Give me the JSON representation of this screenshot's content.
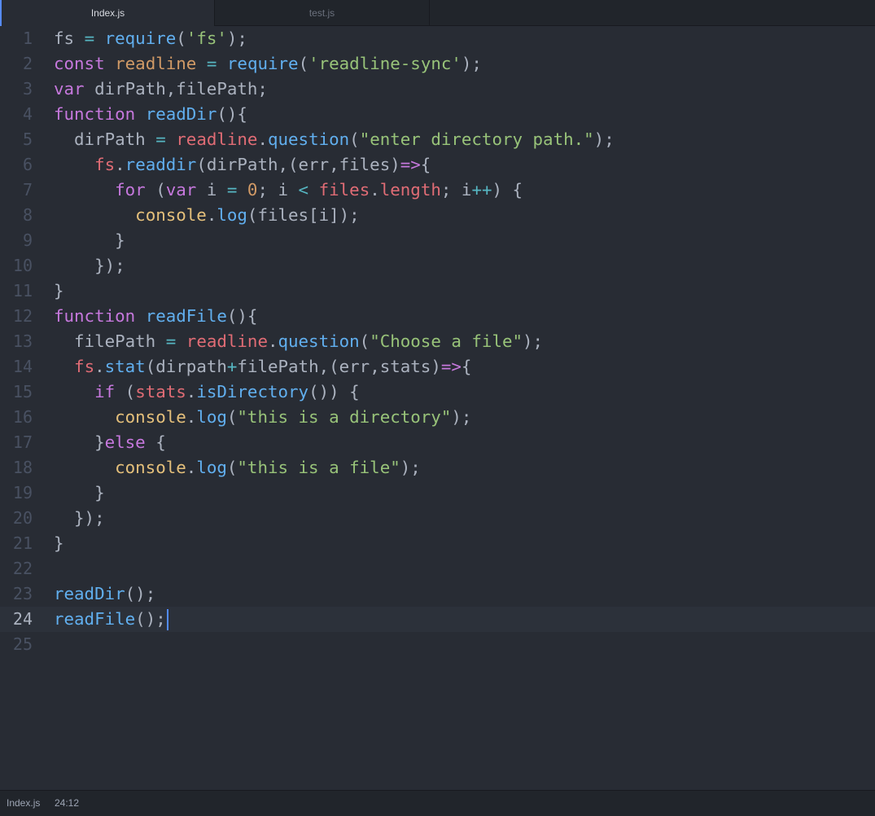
{
  "tabs": [
    {
      "label": "Index.js",
      "active": true
    },
    {
      "label": "test.js",
      "active": false
    }
  ],
  "editor": {
    "language": "javascript",
    "current_line": 24,
    "lines": [
      {
        "n": "1",
        "tokens": [
          [
            "d",
            "fs "
          ],
          [
            "o",
            "="
          ],
          [
            "d",
            " "
          ],
          [
            "f",
            "require"
          ],
          [
            "d",
            "("
          ],
          [
            "s",
            "'fs'"
          ],
          [
            "d",
            ");"
          ]
        ]
      },
      {
        "n": "2",
        "tokens": [
          [
            "k",
            "const"
          ],
          [
            "d",
            " "
          ],
          [
            "n",
            "readline"
          ],
          [
            "d",
            " "
          ],
          [
            "o",
            "="
          ],
          [
            "d",
            " "
          ],
          [
            "f",
            "require"
          ],
          [
            "d",
            "("
          ],
          [
            "s",
            "'readline-sync'"
          ],
          [
            "d",
            ");"
          ]
        ]
      },
      {
        "n": "3",
        "tokens": [
          [
            "k",
            "var"
          ],
          [
            "d",
            " dirPath,filePath;"
          ]
        ]
      },
      {
        "n": "4",
        "tokens": [
          [
            "k",
            "function"
          ],
          [
            "d",
            " "
          ],
          [
            "f",
            "readDir"
          ],
          [
            "d",
            "(){"
          ]
        ]
      },
      {
        "n": "5",
        "tokens": [
          [
            "d",
            "  dirPath "
          ],
          [
            "o",
            "="
          ],
          [
            "d",
            " "
          ],
          [
            "v",
            "readline"
          ],
          [
            "d",
            "."
          ],
          [
            "f",
            "question"
          ],
          [
            "d",
            "("
          ],
          [
            "s",
            "\"enter directory path.\""
          ],
          [
            "d",
            ");"
          ]
        ]
      },
      {
        "n": "6",
        "tokens": [
          [
            "d",
            "    "
          ],
          [
            "v",
            "fs"
          ],
          [
            "d",
            "."
          ],
          [
            "f",
            "readdir"
          ],
          [
            "d",
            "(dirPath,(err,files)"
          ],
          [
            "k",
            "=>"
          ],
          [
            "d",
            "{"
          ]
        ]
      },
      {
        "n": "7",
        "tokens": [
          [
            "d",
            "      "
          ],
          [
            "k",
            "for"
          ],
          [
            "d",
            " ("
          ],
          [
            "k",
            "var"
          ],
          [
            "d",
            " i "
          ],
          [
            "o",
            "="
          ],
          [
            "d",
            " "
          ],
          [
            "n",
            "0"
          ],
          [
            "d",
            "; i "
          ],
          [
            "o",
            "<"
          ],
          [
            "d",
            " "
          ],
          [
            "v",
            "files"
          ],
          [
            "d",
            "."
          ],
          [
            "v",
            "length"
          ],
          [
            "d",
            "; i"
          ],
          [
            "o",
            "++"
          ],
          [
            "d",
            ") {"
          ]
        ]
      },
      {
        "n": "8",
        "tokens": [
          [
            "d",
            "        "
          ],
          [
            "c",
            "console"
          ],
          [
            "d",
            "."
          ],
          [
            "f",
            "log"
          ],
          [
            "d",
            "(files[i]);"
          ]
        ]
      },
      {
        "n": "9",
        "tokens": [
          [
            "d",
            "      }"
          ]
        ]
      },
      {
        "n": "10",
        "tokens": [
          [
            "d",
            "    });"
          ]
        ]
      },
      {
        "n": "11",
        "tokens": [
          [
            "d",
            "}"
          ]
        ]
      },
      {
        "n": "12",
        "tokens": [
          [
            "k",
            "function"
          ],
          [
            "d",
            " "
          ],
          [
            "f",
            "readFile"
          ],
          [
            "d",
            "(){"
          ]
        ]
      },
      {
        "n": "13",
        "tokens": [
          [
            "d",
            "  filePath "
          ],
          [
            "o",
            "="
          ],
          [
            "d",
            " "
          ],
          [
            "v",
            "readline"
          ],
          [
            "d",
            "."
          ],
          [
            "f",
            "question"
          ],
          [
            "d",
            "("
          ],
          [
            "s",
            "\"Choose a file\""
          ],
          [
            "d",
            ");"
          ]
        ]
      },
      {
        "n": "14",
        "tokens": [
          [
            "d",
            "  "
          ],
          [
            "v",
            "fs"
          ],
          [
            "d",
            "."
          ],
          [
            "f",
            "stat"
          ],
          [
            "d",
            "(dirpath"
          ],
          [
            "o",
            "+"
          ],
          [
            "d",
            "filePath,(err,stats)"
          ],
          [
            "k",
            "=>"
          ],
          [
            "d",
            "{"
          ]
        ]
      },
      {
        "n": "15",
        "tokens": [
          [
            "d",
            "    "
          ],
          [
            "k",
            "if"
          ],
          [
            "d",
            " ("
          ],
          [
            "v",
            "stats"
          ],
          [
            "d",
            "."
          ],
          [
            "f",
            "isDirectory"
          ],
          [
            "d",
            "()) {"
          ]
        ]
      },
      {
        "n": "16",
        "tokens": [
          [
            "d",
            "      "
          ],
          [
            "c",
            "console"
          ],
          [
            "d",
            "."
          ],
          [
            "f",
            "log"
          ],
          [
            "d",
            "("
          ],
          [
            "s",
            "\"this is a directory\""
          ],
          [
            "d",
            ");"
          ]
        ]
      },
      {
        "n": "17",
        "tokens": [
          [
            "d",
            "    }"
          ],
          [
            "k",
            "else"
          ],
          [
            "d",
            " {"
          ]
        ]
      },
      {
        "n": "18",
        "tokens": [
          [
            "d",
            "      "
          ],
          [
            "c",
            "console"
          ],
          [
            "d",
            "."
          ],
          [
            "f",
            "log"
          ],
          [
            "d",
            "("
          ],
          [
            "s",
            "\"this is a file\""
          ],
          [
            "d",
            ");"
          ]
        ]
      },
      {
        "n": "19",
        "tokens": [
          [
            "d",
            "    }"
          ]
        ]
      },
      {
        "n": "20",
        "tokens": [
          [
            "d",
            "  });"
          ]
        ]
      },
      {
        "n": "21",
        "tokens": [
          [
            "d",
            "}"
          ]
        ]
      },
      {
        "n": "22",
        "tokens": []
      },
      {
        "n": "23",
        "tokens": [
          [
            "f",
            "readDir"
          ],
          [
            "d",
            "();"
          ]
        ]
      },
      {
        "n": "24",
        "tokens": [
          [
            "f",
            "readFile"
          ],
          [
            "d",
            "();"
          ]
        ]
      },
      {
        "n": "25",
        "tokens": []
      }
    ]
  },
  "status_bar": {
    "file_name": "Index.js",
    "cursor_position": "24:12"
  },
  "colors": {
    "background": "#282c34",
    "keyword": "#c678dd",
    "function": "#61afef",
    "string": "#98c379",
    "operator": "#56b6c2",
    "variable": "#e06c75",
    "class": "#e5c07b",
    "number": "#d19a66",
    "cursor": "#528bff"
  }
}
